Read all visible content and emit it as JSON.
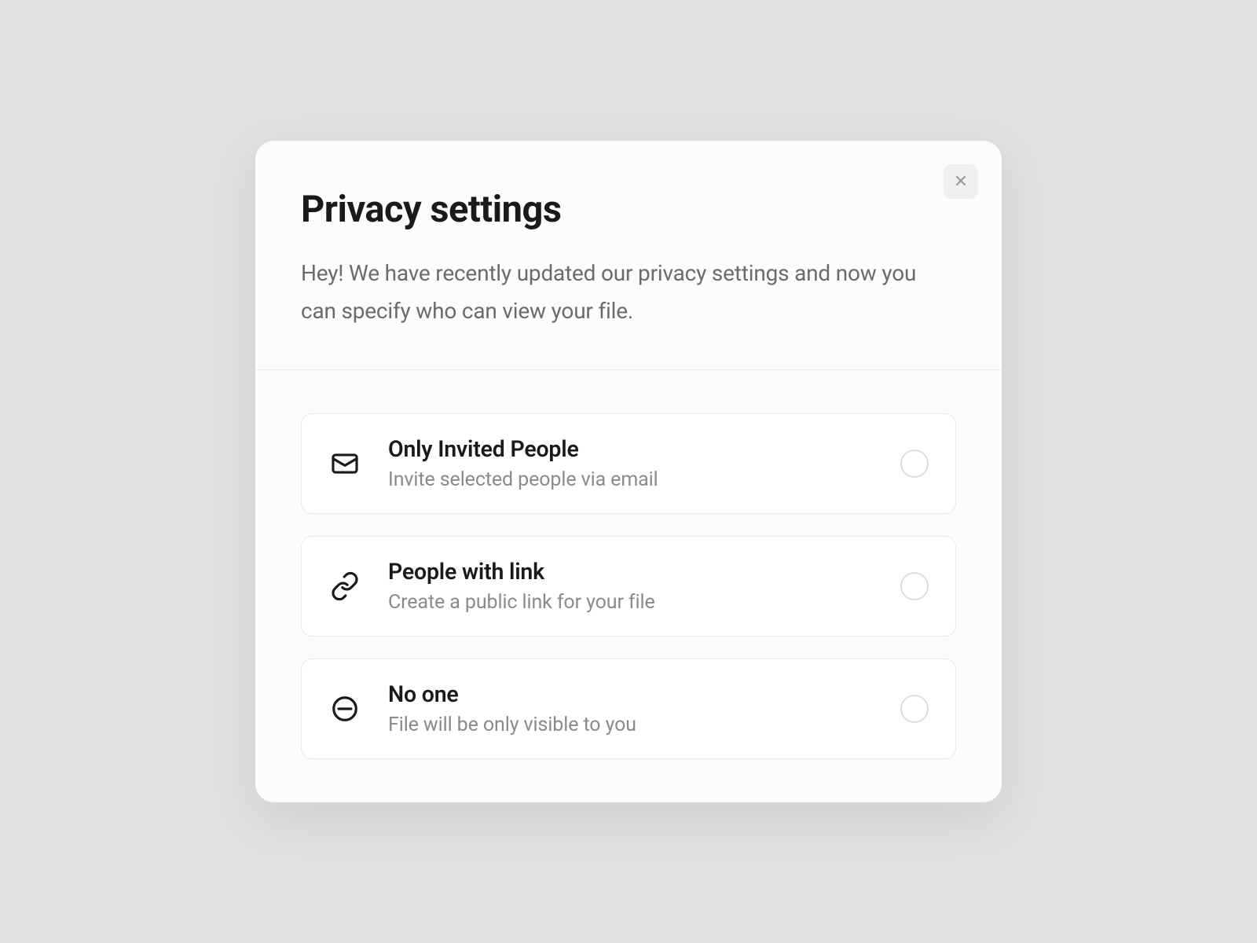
{
  "modal": {
    "title": "Privacy settings",
    "description": "Hey! We have recently updated our privacy settings and now you can specify who can view your file.",
    "options": [
      {
        "title": "Only Invited People",
        "subtitle": "Invite selected people via email"
      },
      {
        "title": "People with link",
        "subtitle": "Create a public link for your file"
      },
      {
        "title": "No one",
        "subtitle": "File will be only visible to you"
      }
    ]
  }
}
